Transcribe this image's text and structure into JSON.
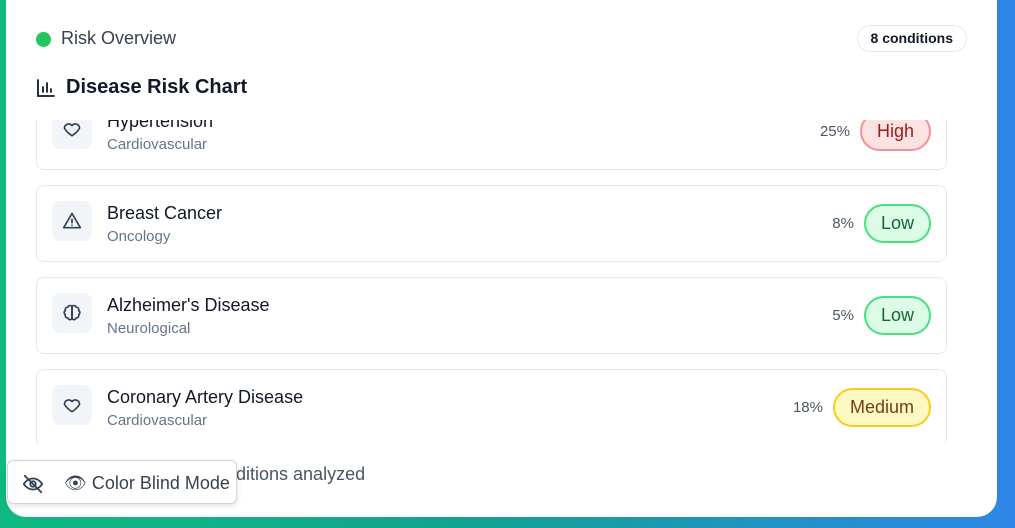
{
  "header": {
    "overview_label": "Risk Overview",
    "count_badge": "8 conditions",
    "status_color": "#22c55e"
  },
  "chart": {
    "title": "Disease Risk Chart",
    "icon": "bar-chart-icon"
  },
  "conditions": [
    {
      "name": "Hypertension",
      "category": "Cardiovascular",
      "percent": "25%",
      "level": "High",
      "icon": "heart-icon"
    },
    {
      "name": "Breast Cancer",
      "category": "Oncology",
      "percent": "8%",
      "level": "Low",
      "icon": "warning-triangle-icon"
    },
    {
      "name": "Alzheimer's Disease",
      "category": "Neurological",
      "percent": "5%",
      "level": "Low",
      "icon": "brain-icon"
    },
    {
      "name": "Coronary Artery Disease",
      "category": "Cardiovascular",
      "percent": "18%",
      "level": "Medium",
      "icon": "heart-icon"
    }
  ],
  "footer": {
    "summary_text": "ditions analyzed"
  },
  "color_blind_toggle": {
    "label": "👁 Color Blind Mode",
    "icon": "eye-off-icon"
  },
  "colors": {
    "high": "#f19494",
    "low": "#4ade80",
    "medium": "#facc15"
  }
}
